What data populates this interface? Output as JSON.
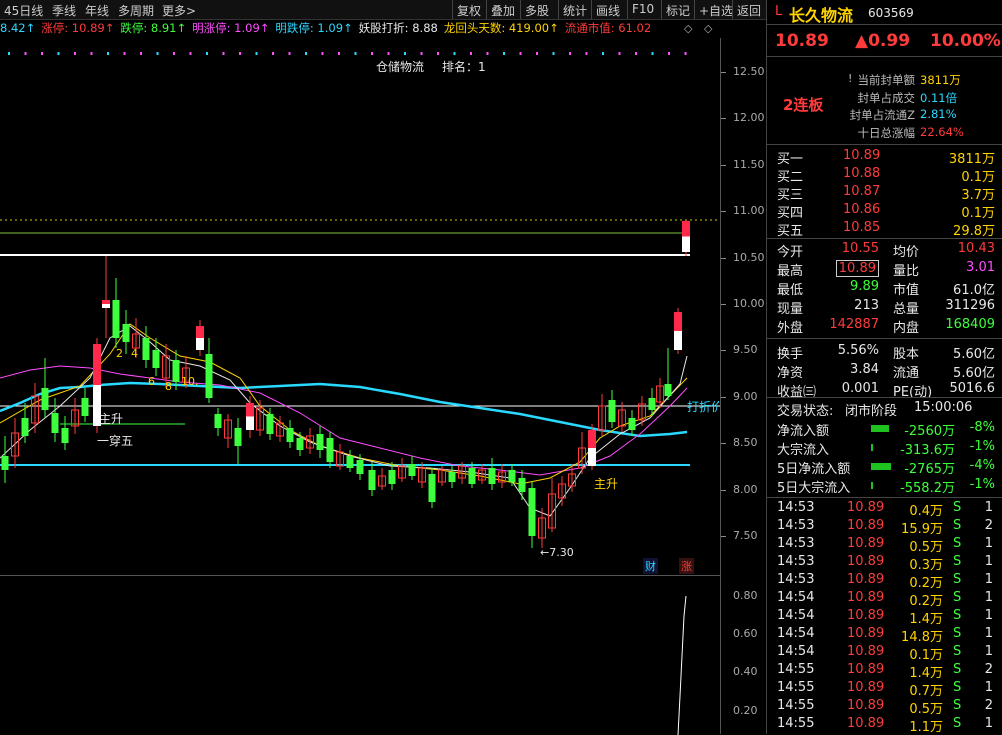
{
  "toolbar": {
    "left": [
      "45日线",
      "季线",
      "年线",
      "多周期",
      "更多>"
    ],
    "right": [
      "复权",
      "叠加",
      "多股",
      "统计",
      "画线",
      "F10",
      "标记",
      "+自选",
      "返回"
    ]
  },
  "indicators": [
    {
      "text": "8.42↑",
      "color": "#2ad9ff"
    },
    {
      "text": "涨停: 10.89↑",
      "color": "#ff3b3b"
    },
    {
      "text": "跌停: 8.91↑",
      "color": "#3dff3d"
    },
    {
      "text": "明涨停: 1.09↑",
      "color": "#ff4dff"
    },
    {
      "text": "明跌停: 1.09↑",
      "color": "#2ad9ff"
    },
    {
      "text": "妖股打折: 8.88",
      "color": "#e8e8e8"
    },
    {
      "text": "龙回头天数: 419.00↑",
      "color": "#ffd400"
    },
    {
      "text": "流通市值: 61.02",
      "color": "#ff3b3b"
    }
  ],
  "chart_labels": {
    "title": "仓储物流",
    "rank": "排名：1",
    "label_zhusheng1": "主升",
    "label_yichuanwu": "一穿五",
    "label_zhusheng2": "主升",
    "label_dazhe": "打折价",
    "label_low": "←7.30",
    "n2": "2",
    "n4": "4",
    "n6": "6",
    "n8": "8",
    "n10": "10.",
    "badge_cai": "财",
    "badge_zhang": "涨"
  },
  "y_ticks": [
    "12.50",
    "12.00",
    "11.50",
    "11.00",
    "10.50",
    "10.00",
    "9.50",
    "9.00",
    "8.50",
    "8.00",
    "7.50"
  ],
  "vol_ticks": [
    "0.80",
    "0.60",
    "0.40",
    "0.20"
  ],
  "stock": {
    "prefix": "L",
    "name": "长久物流",
    "code": "603569",
    "price": "10.89",
    "change": "▲0.99",
    "pct": "10.00%",
    "streak": "2连板"
  },
  "seal": [
    {
      "label": "当前封单额",
      "value": "3811万",
      "color": "#ffd400"
    },
    {
      "label": "封单占成交",
      "value": "0.11倍",
      "color": "#2ad9ff"
    },
    {
      "label": "封单占流通Z",
      "value": "2.81%",
      "color": "#2ad9ff"
    },
    {
      "label": "十日总涨幅",
      "value": "22.64%",
      "color": "#ff3b3b"
    }
  ],
  "order_book": [
    {
      "label": "买一",
      "price": "10.89",
      "vol": "3811万"
    },
    {
      "label": "买二",
      "price": "10.88",
      "vol": "0.1万"
    },
    {
      "label": "买三",
      "price": "10.87",
      "vol": "3.7万"
    },
    {
      "label": "买四",
      "price": "10.86",
      "vol": "0.1万"
    },
    {
      "label": "买五",
      "price": "10.85",
      "vol": "29.8万"
    }
  ],
  "stats": [
    {
      "l1": "今开",
      "v1": "10.55",
      "c1": "#ff3b3b",
      "l2": "均价",
      "v2": "10.43",
      "c2": "#ff3b3b"
    },
    {
      "l1": "最高",
      "v1": "10.89",
      "c1": "#ff3b3b",
      "l2": "量比",
      "v2": "3.01",
      "c2": "#ff4dff"
    },
    {
      "l1": "最低",
      "v1": "9.89",
      "c1": "#3dff3d",
      "l2": "市值",
      "v2": "61.0亿",
      "c2": "#e8e8e8"
    },
    {
      "l1": "现量",
      "v1": "213",
      "c1": "#e8e8e8",
      "l2": "总量",
      "v2": "311296",
      "c2": "#e8e8e8"
    },
    {
      "l1": "外盘",
      "v1": "142887",
      "c1": "#ff3b3b",
      "l2": "内盘",
      "v2": "168409",
      "c2": "#3dff3d"
    },
    {
      "l1": "换手",
      "v1": "5.56%",
      "c1": "#e8e8e8",
      "l2": "股本",
      "v2": "5.60亿",
      "c2": "#e8e8e8"
    },
    {
      "l1": "净资",
      "v1": "3.84",
      "c1": "#e8e8e8",
      "l2": "流通",
      "v2": "5.60亿",
      "c2": "#e8e8e8"
    },
    {
      "l1": "收益㈢",
      "v1": "0.001",
      "c1": "#e8e8e8",
      "l2": "PE(动)",
      "v2": "5016.6",
      "c2": "#e8e8e8"
    }
  ],
  "trade_status": {
    "label": "交易状态:",
    "status": "闭市阶段",
    "time": "15:00:06"
  },
  "flows": [
    {
      "label": "净流入额",
      "value": "-2560万",
      "pct": "-8%",
      "bar": 0.8
    },
    {
      "label": "大宗流入",
      "value": "-313.6万",
      "pct": "-1%",
      "bar": 0.1
    },
    {
      "label": "5日净流入额",
      "value": "-2765万",
      "pct": "-4%",
      "bar": 0.9
    },
    {
      "label": "5日大宗流入",
      "value": "-558.2万",
      "pct": "-1%",
      "bar": 0.1
    }
  ],
  "ticks": [
    {
      "time": "14:53",
      "price": "10.89",
      "vol": "0.4万",
      "side": "S",
      "n": "1"
    },
    {
      "time": "14:53",
      "price": "10.89",
      "vol": "15.9万",
      "side": "S",
      "n": "2"
    },
    {
      "time": "14:53",
      "price": "10.89",
      "vol": "0.5万",
      "side": "S",
      "n": "1"
    },
    {
      "time": "14:53",
      "price": "10.89",
      "vol": "0.3万",
      "side": "S",
      "n": "1"
    },
    {
      "time": "14:53",
      "price": "10.89",
      "vol": "0.2万",
      "side": "S",
      "n": "1"
    },
    {
      "time": "14:54",
      "price": "10.89",
      "vol": "0.2万",
      "side": "S",
      "n": "1"
    },
    {
      "time": "14:54",
      "price": "10.89",
      "vol": "1.4万",
      "side": "S",
      "n": "1"
    },
    {
      "time": "14:54",
      "price": "10.89",
      "vol": "14.8万",
      "side": "S",
      "n": "1"
    },
    {
      "time": "14:54",
      "price": "10.89",
      "vol": "0.1万",
      "side": "S",
      "n": "1"
    },
    {
      "time": "14:55",
      "price": "10.89",
      "vol": "1.4万",
      "side": "S",
      "n": "2"
    },
    {
      "time": "14:55",
      "price": "10.89",
      "vol": "0.7万",
      "side": "S",
      "n": "1"
    },
    {
      "time": "14:55",
      "price": "10.89",
      "vol": "0.5万",
      "side": "S",
      "n": "2"
    },
    {
      "time": "14:55",
      "price": "10.89",
      "vol": "1.1万",
      "side": "S",
      "n": "1"
    }
  ]
}
